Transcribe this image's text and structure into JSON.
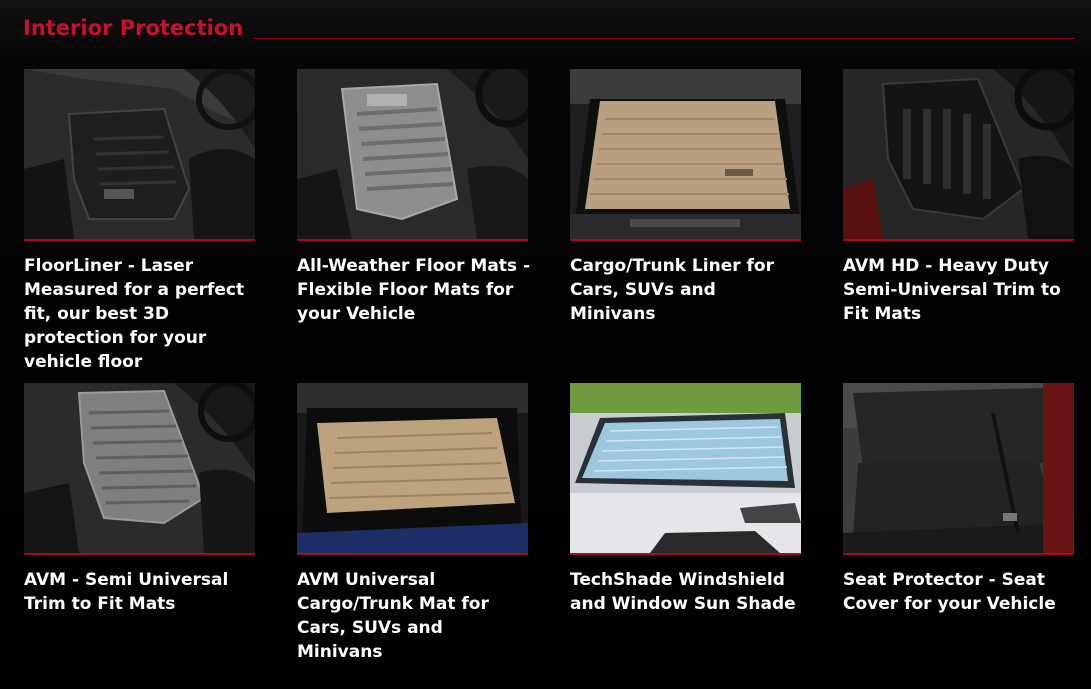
{
  "section": {
    "title": "Interior Protection"
  },
  "products": [
    {
      "title": "FloorLiner - Laser Measured for a perfect fit, our best 3D protection for your vehicle floor",
      "image_icon": "floorliner-photo"
    },
    {
      "title": "All-Weather Floor Mats - Flexible Floor Mats for your Vehicle",
      "image_icon": "all-weather-mat-photo"
    },
    {
      "title": "Cargo/Trunk Liner for Cars, SUVs and Minivans",
      "image_icon": "cargo-liner-photo"
    },
    {
      "title": "AVM HD - Heavy Duty Semi-Universal Trim to Fit Mats",
      "image_icon": "avm-hd-mat-photo"
    },
    {
      "title": "AVM - Semi Universal Trim to Fit Mats",
      "image_icon": "avm-mat-photo"
    },
    {
      "title": "AVM Universal Cargo/Trunk Mat for Cars, SUVs and Minivans",
      "image_icon": "avm-cargo-mat-photo"
    },
    {
      "title": "TechShade Windshield and Window Sun Shade",
      "image_icon": "techshade-photo"
    },
    {
      "title": "Seat Protector - Seat Cover for your Vehicle",
      "image_icon": "seat-protector-photo"
    }
  ],
  "colors": {
    "accent": "#c8102e",
    "background": "#000000",
    "text": "#ffffff"
  }
}
